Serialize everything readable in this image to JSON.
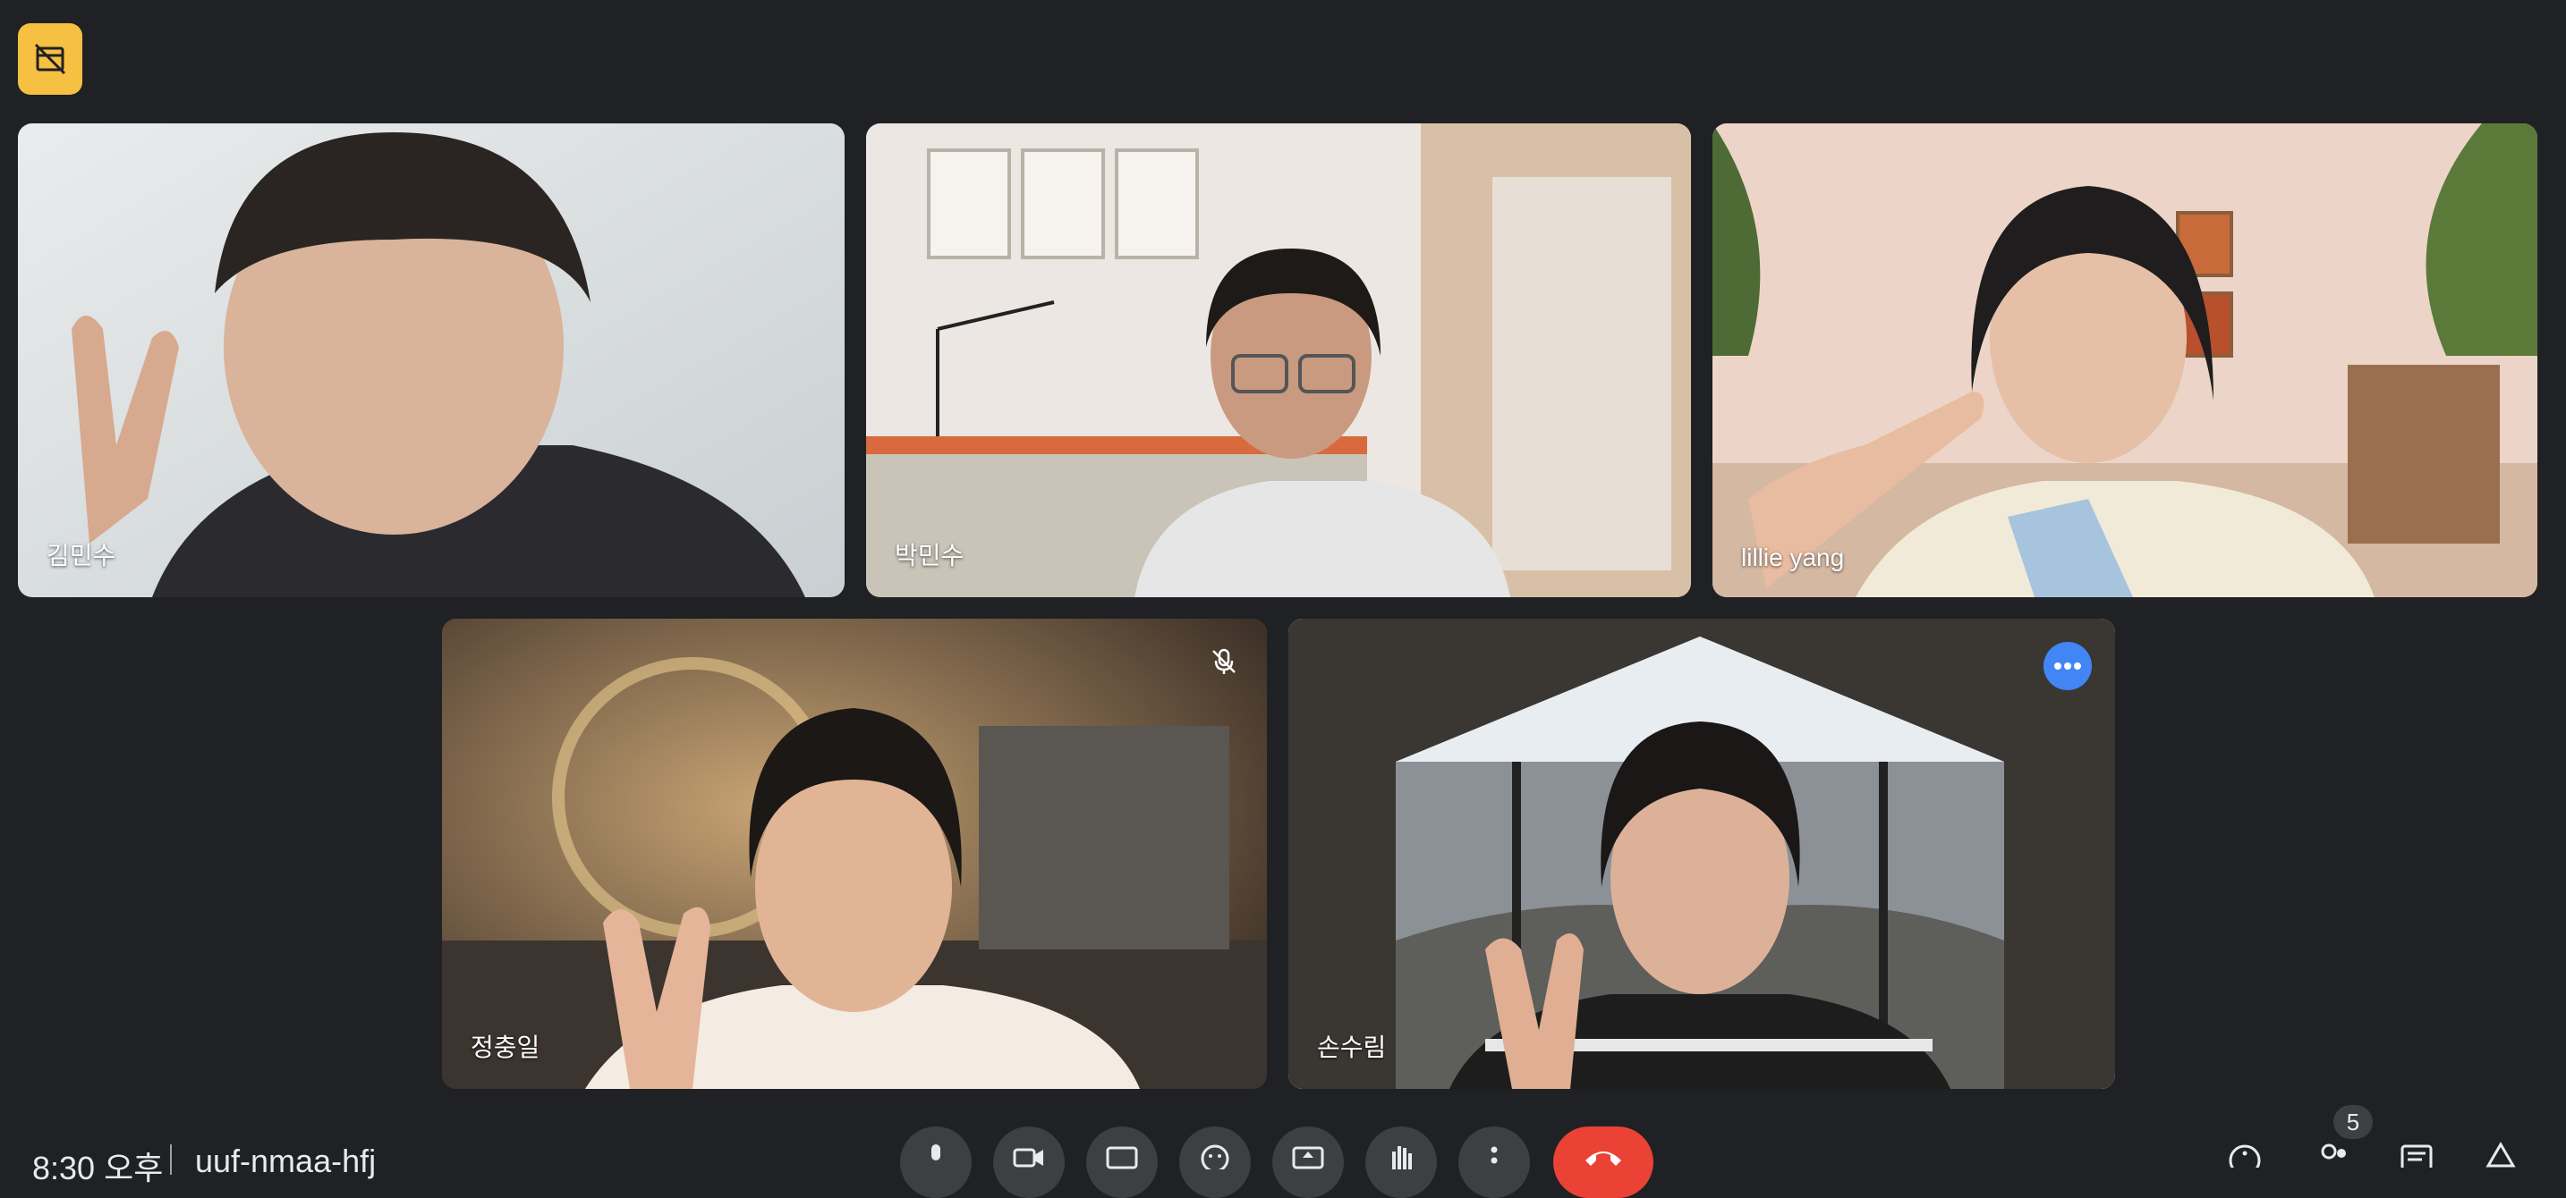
{
  "participants": [
    {
      "name": "김민수"
    },
    {
      "name": "박민수"
    },
    {
      "name": "lillie yang"
    },
    {
      "name": "정충일",
      "muted": true
    },
    {
      "name": "손수림",
      "speaking": true
    }
  ],
  "bottom_bar": {
    "time": "8:30 오후",
    "meeting_code": "uuf-nmaa-hfj",
    "participant_count": "5"
  },
  "colors": {
    "background": "#202124",
    "badge": "#f6c042",
    "speaking_outline": "#8ab4f8",
    "hangup": "#ea4335"
  },
  "icons": [
    "recording-off-icon",
    "mic-off-icon",
    "more-options-icon",
    "mic-icon",
    "camera-icon",
    "captions-icon",
    "emoji-icon",
    "present-icon",
    "raise-hand-icon",
    "more-vert-icon",
    "hangup-icon",
    "info-icon",
    "people-icon",
    "chat-icon",
    "activities-icon"
  ]
}
